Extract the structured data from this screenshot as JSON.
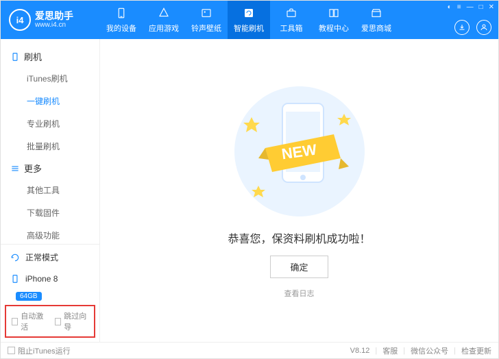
{
  "app": {
    "title": "爱思助手",
    "subtitle": "www.i4.cn"
  },
  "nav": [
    {
      "label": "我的设备"
    },
    {
      "label": "应用游戏"
    },
    {
      "label": "铃声壁纸"
    },
    {
      "label": "智能刷机",
      "active": true
    },
    {
      "label": "工具箱"
    },
    {
      "label": "教程中心"
    },
    {
      "label": "爱思商城"
    }
  ],
  "sidebar": {
    "group1": {
      "title": "刷机",
      "items": [
        "iTunes刷机",
        "一键刷机",
        "专业刷机",
        "批量刷机"
      ],
      "activeIndex": 1
    },
    "group2": {
      "title": "更多",
      "items": [
        "其他工具",
        "下载固件",
        "高级功能"
      ]
    },
    "mode": "正常模式",
    "device": {
      "name": "iPhone 8",
      "storage": "64GB"
    },
    "checks": {
      "autoActivate": "自动激活",
      "skipGuide": "跳过向导"
    }
  },
  "main": {
    "message": "恭喜您，保资料刷机成功啦！",
    "ok": "确定",
    "viewLog": "查看日志",
    "ribbonText": "NEW"
  },
  "footer": {
    "blockItunes": "阻止iTunes运行",
    "version": "V8.12",
    "support": "客服",
    "wechat": "微信公众号",
    "update": "检查更新"
  }
}
